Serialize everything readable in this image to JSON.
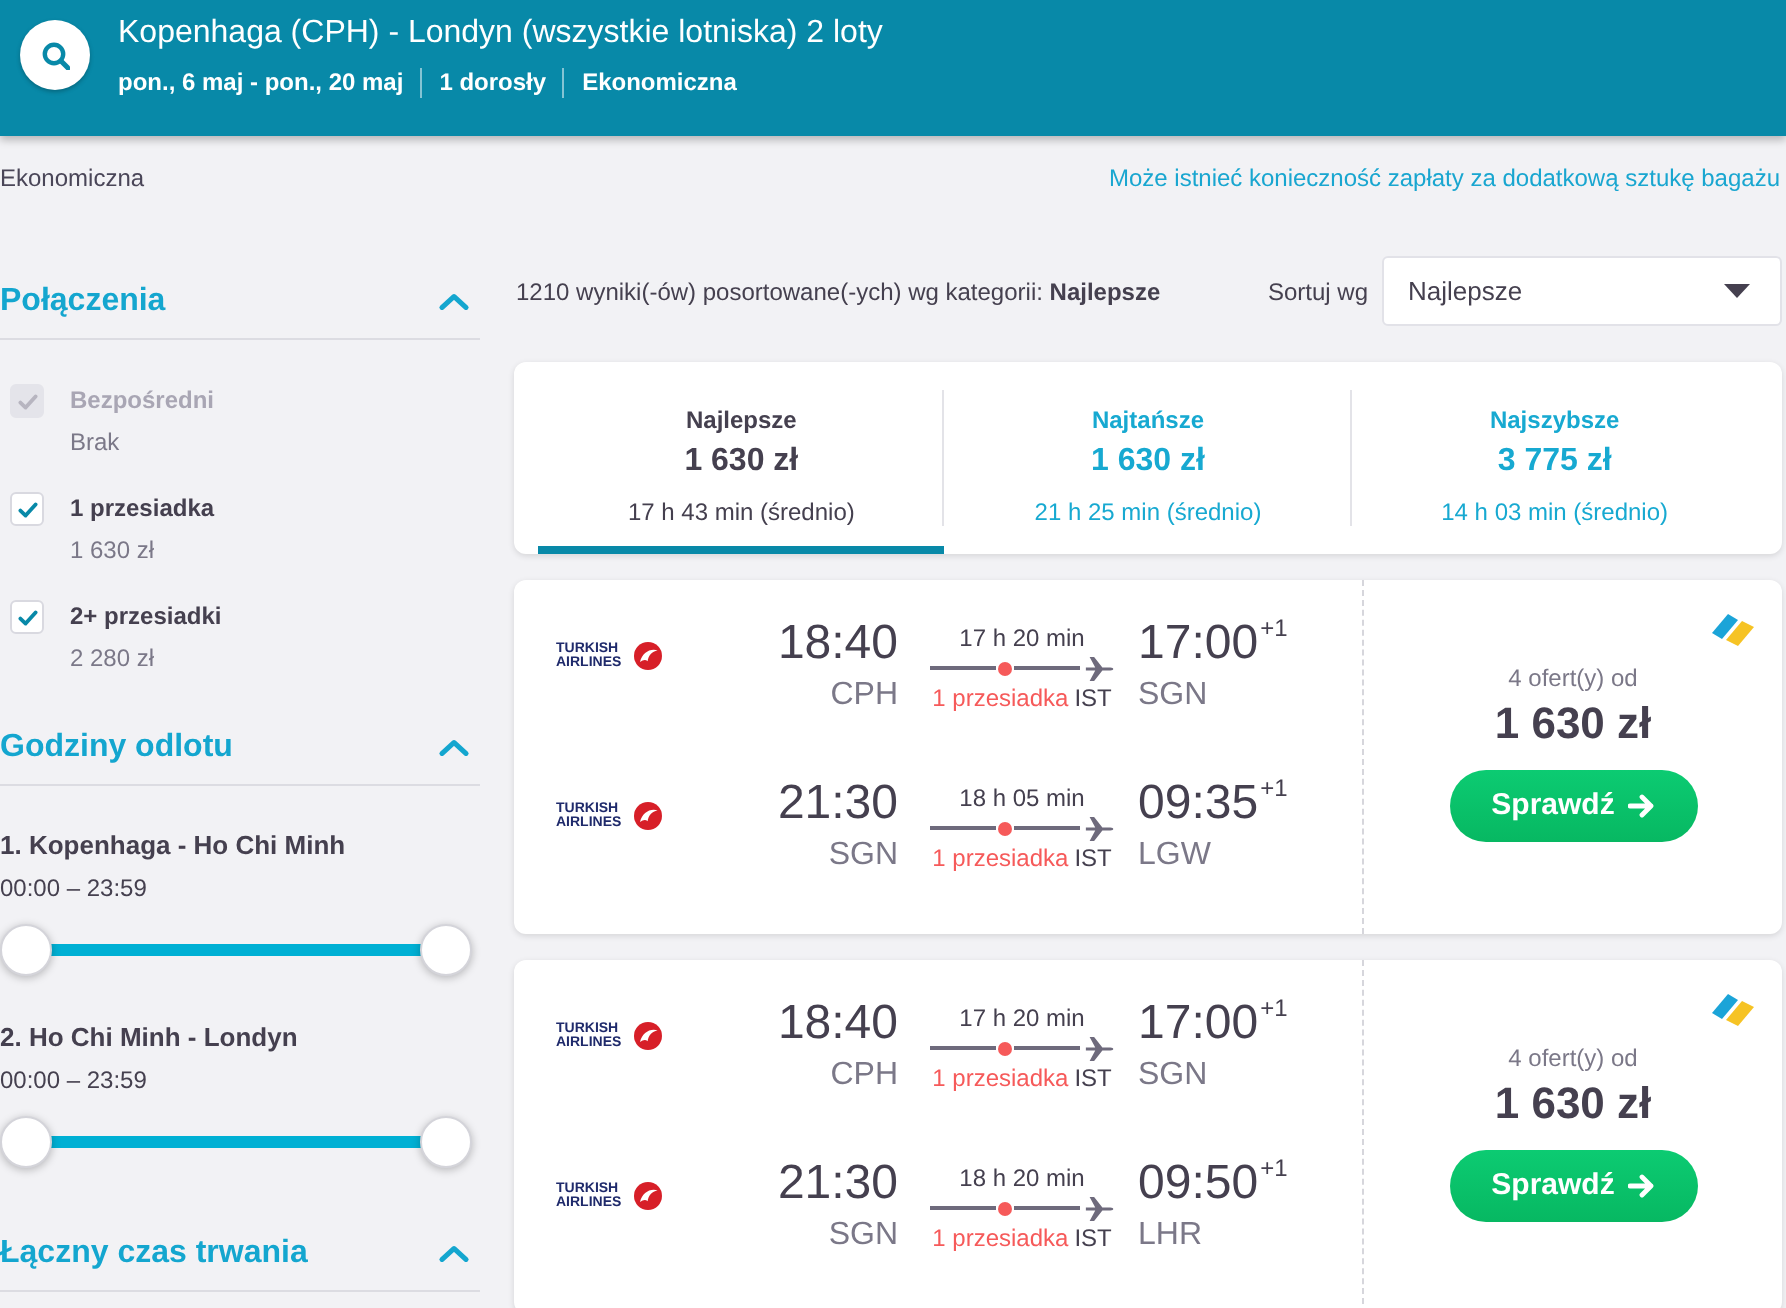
{
  "header": {
    "title": "Kopenhaga (CPH) - Londyn (wszystkie lotniska) 2 loty",
    "details": [
      "pon., 6 maj - pon., 20 maj",
      "1 dorosły",
      "Ekonomiczna"
    ]
  },
  "toolbar": {
    "cabin": "Ekonomiczna",
    "baggage_notice": "Może istnieć konieczność zapłaty za dodatkową sztukę bagażu"
  },
  "filters": [
    {
      "kind": "checkboxes",
      "title": "Połączenia",
      "expanded": true,
      "options": [
        {
          "label": "Bezpośredni",
          "price": "Brak",
          "checked": true,
          "disabled": true
        },
        {
          "label": "1 przesiadka",
          "price": "1 630 zł",
          "checked": true,
          "disabled": false
        },
        {
          "label": "2+ przesiadki",
          "price": "2 280 zł",
          "checked": true,
          "disabled": false
        }
      ]
    },
    {
      "kind": "time-ranges",
      "title": "Godziny odlotu",
      "expanded": true,
      "sliders": [
        {
          "label": "1. Kopenhaga - Ho Chi Minh",
          "range": "00:00 – 23:59",
          "thumbs": [
            {
              "level": 0
            },
            {
              "level": 1
            }
          ]
        },
        {
          "label": "2. Ho Chi Minh - Londyn",
          "range": "00:00 – 23:59",
          "thumbs": [
            {
              "level": 0
            },
            {
              "level": 1
            }
          ]
        }
      ]
    },
    {
      "kind": "duration",
      "title": "Łączny czas trwania",
      "expanded": true
    }
  ],
  "results": {
    "summary": "1210 wyniki(-ów) posortowane(-ych) wg kategorii: **Najlepsze**",
    "sort_label": "Sortuj wg",
    "sort_value": "Najlepsze"
  },
  "sort_tabs": [
    {
      "label": "Najlepsze",
      "price": "1 630 zł",
      "duration": "17 h 43 min (średnio)",
      "selected": true
    },
    {
      "label": "Najtańsze",
      "price": "1 630 zł",
      "duration": "21 h 25 min (średnio)",
      "selected": false
    },
    {
      "label": "Najszybsze",
      "price": "3 775 zł",
      "duration": "14 h 03 min (średnio)",
      "selected": false
    }
  ],
  "flights": [
    {
      "offers": "4 ofert(y) od",
      "price": "1 630 zł",
      "button": "Sprawdź",
      "legs": [
        {
          "airline": "TURKISH AIRLINES",
          "depart_time": "18:40",
          "depart_airport": "CPH",
          "duration": "17 h 20 min",
          "stops": "1 przesiadka",
          "via": "IST",
          "arrive_time": "17:00",
          "day_offset": "+1",
          "arrive_airport": "SGN"
        },
        {
          "airline": "TURKISH AIRLINES",
          "depart_time": "21:30",
          "depart_airport": "SGN",
          "duration": "18 h 05 min",
          "stops": "1 przesiadka",
          "via": "IST",
          "arrive_time": "09:35",
          "day_offset": "+1",
          "arrive_airport": "LGW"
        }
      ]
    },
    {
      "offers": "4 ofert(y) od",
      "price": "1 630 zł",
      "button": "Sprawdź",
      "legs": [
        {
          "airline": "TURKISH AIRLINES",
          "depart_time": "18:40",
          "depart_airport": "CPH",
          "duration": "17 h 20 min",
          "stops": "1 przesiadka",
          "via": "IST",
          "arrive_time": "17:00",
          "day_offset": "+1",
          "arrive_airport": "SGN"
        },
        {
          "airline": "TURKISH AIRLINES",
          "depart_time": "21:30",
          "depart_airport": "SGN",
          "duration": "18 h 20 min",
          "stops": "1 przesiadka",
          "via": "IST",
          "arrive_time": "09:50",
          "day_offset": "+1",
          "arrive_airport": "LHR"
        }
      ]
    }
  ]
}
